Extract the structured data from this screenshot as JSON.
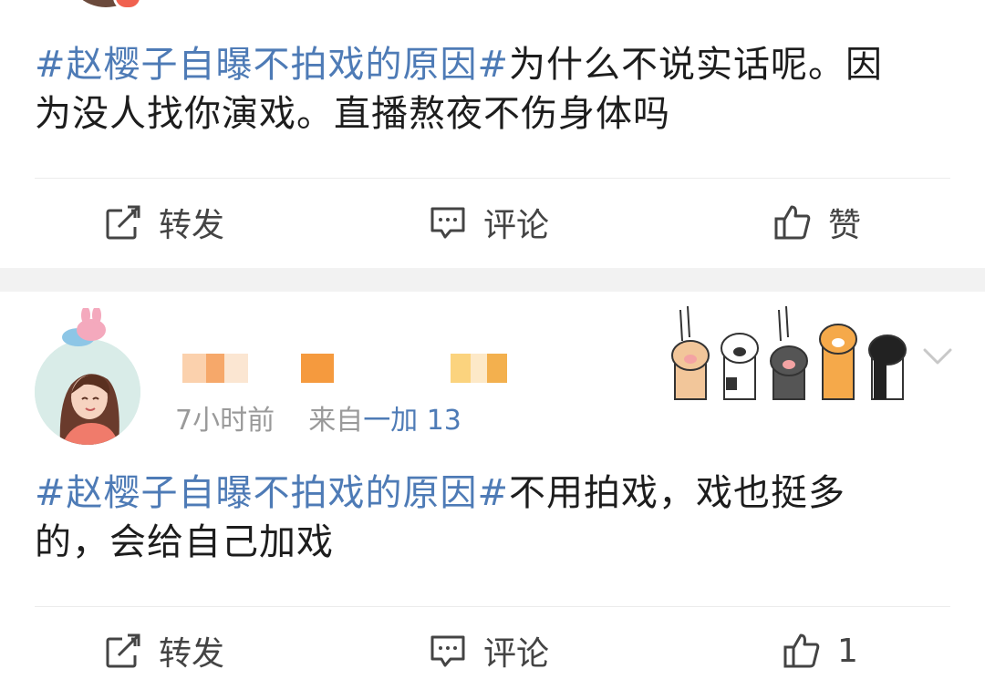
{
  "post1": {
    "hashtag": "#赵樱子自曝不拍戏的原因#",
    "line1_rest": "为什么不说实话呢。因",
    "line2": "为没人找你演戏。直播熬夜不伤身体吗",
    "actions": {
      "repost": "转发",
      "comment": "评论",
      "like": "赞"
    }
  },
  "post2": {
    "time": "7小时前",
    "source_prefix": "来自",
    "source": "一加 13",
    "hashtag": "#赵樱子自曝不拍戏的原因#",
    "line1_rest": "不用拍戏，戏也挺多",
    "line2": "的，会给自己加戏",
    "actions": {
      "repost": "转发",
      "comment": "评论",
      "like_count": "1"
    }
  },
  "icons": [
    "repost-icon",
    "comment-icon",
    "like-icon",
    "chevron-down-icon",
    "cat-paws-sticker",
    "avatar-girl"
  ],
  "colors": {
    "hashtag": "#4e7bb6",
    "separator_band": "#f2f2f2",
    "meta": "#9a9a9a",
    "blur_orange": "#f59a3e"
  }
}
